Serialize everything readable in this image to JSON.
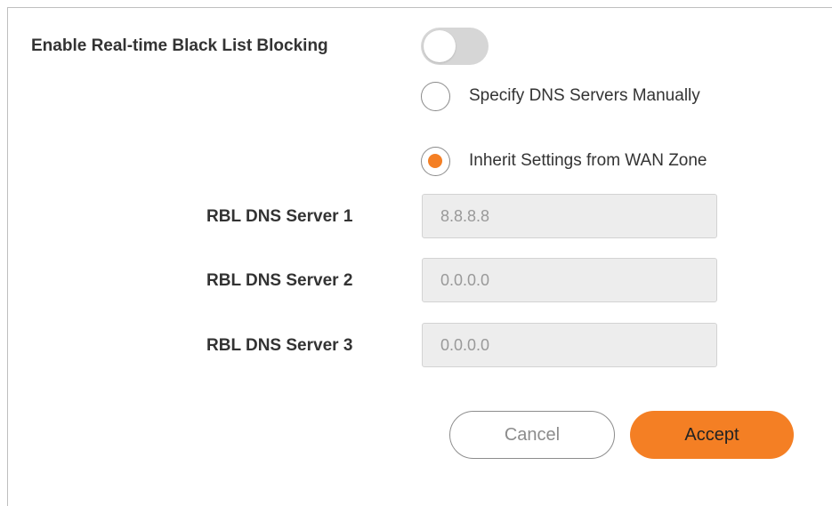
{
  "dialog": {
    "rbl_toggle": {
      "label": "Enable Real-time Black List Blocking",
      "enabled": false
    },
    "dns_mode": {
      "options": [
        {
          "label": "Specify DNS Servers Manually",
          "selected": false
        },
        {
          "label": "Inherit Settings from WAN Zone",
          "selected": true
        }
      ]
    },
    "servers": [
      {
        "label": "RBL DNS Server 1",
        "value": "8.8.8.8"
      },
      {
        "label": "RBL DNS Server 2",
        "value": "0.0.0.0"
      },
      {
        "label": "RBL DNS Server 3",
        "value": "0.0.0.0"
      }
    ],
    "buttons": {
      "cancel": "Cancel",
      "accept": "Accept"
    },
    "colors": {
      "accent": "#f47f24",
      "toggle_off": "#d6d6d6",
      "field_bg": "#ededed"
    }
  }
}
